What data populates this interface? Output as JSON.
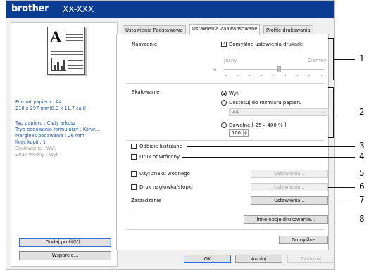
{
  "titlebar": {
    "brand": "brother",
    "model": "XX-XXX"
  },
  "preview": {
    "letter": "A"
  },
  "info": {
    "paper_format": "Format papieru : A4",
    "paper_size": "210 x 297 mm(8.3 x 11.7 cali)",
    "paper_type": "Typ papieru : Cięty arkusz",
    "feed_mode": "Tryb podawania formularzy : Konie...",
    "feed_margin": "Margines podawania : 26 mm",
    "copies": "Ilość kopii : 1",
    "scaling": "Skalowanie : Wył.",
    "watermark": "Znak Wodny : Wył."
  },
  "left_buttons": {
    "add_profile": "Dodaj profil(V)...",
    "support": "Wsparcie..."
  },
  "tabs": [
    {
      "label": "Ustawienia Podstawowe"
    },
    {
      "label": "Ustawienia Zaawansowane"
    },
    {
      "label": "Profile drukowania"
    }
  ],
  "saturation": {
    "label": "Nasycenie",
    "default_checkbox": "Domyślne ustawienia drukarki",
    "light": "Jasny",
    "dark": "Ciemny",
    "value": "6",
    "level": 5,
    "level_max": 9
  },
  "scaling": {
    "label": "Skalowanie",
    "off": "Wył.",
    "fit": "Dostosuj do rozmiaru papieru",
    "fit_select": "A4",
    "custom": "Dowolne [ 25 – 400 % ]",
    "custom_value": "100"
  },
  "options": {
    "mirror": "Odbicie lustrzane",
    "reverse": "Druk odwrócony",
    "watermark": "Użyj znaku wodnego",
    "header_footer": "Druk nagłówka/stopki",
    "management": "Zarządzanie"
  },
  "buttons": {
    "watermark_settings": "Ustawienia...",
    "header_settings": "Ustawienia...",
    "management_settings": "Ustawienia...",
    "other_options": "Inne opcje drukowania...",
    "defaults": "Domyślne",
    "ok": "OK",
    "cancel": "Anuluj",
    "apply": "Zastosuj"
  },
  "callouts": [
    "1",
    "2",
    "3",
    "4",
    "5",
    "6",
    "7",
    "8"
  ]
}
